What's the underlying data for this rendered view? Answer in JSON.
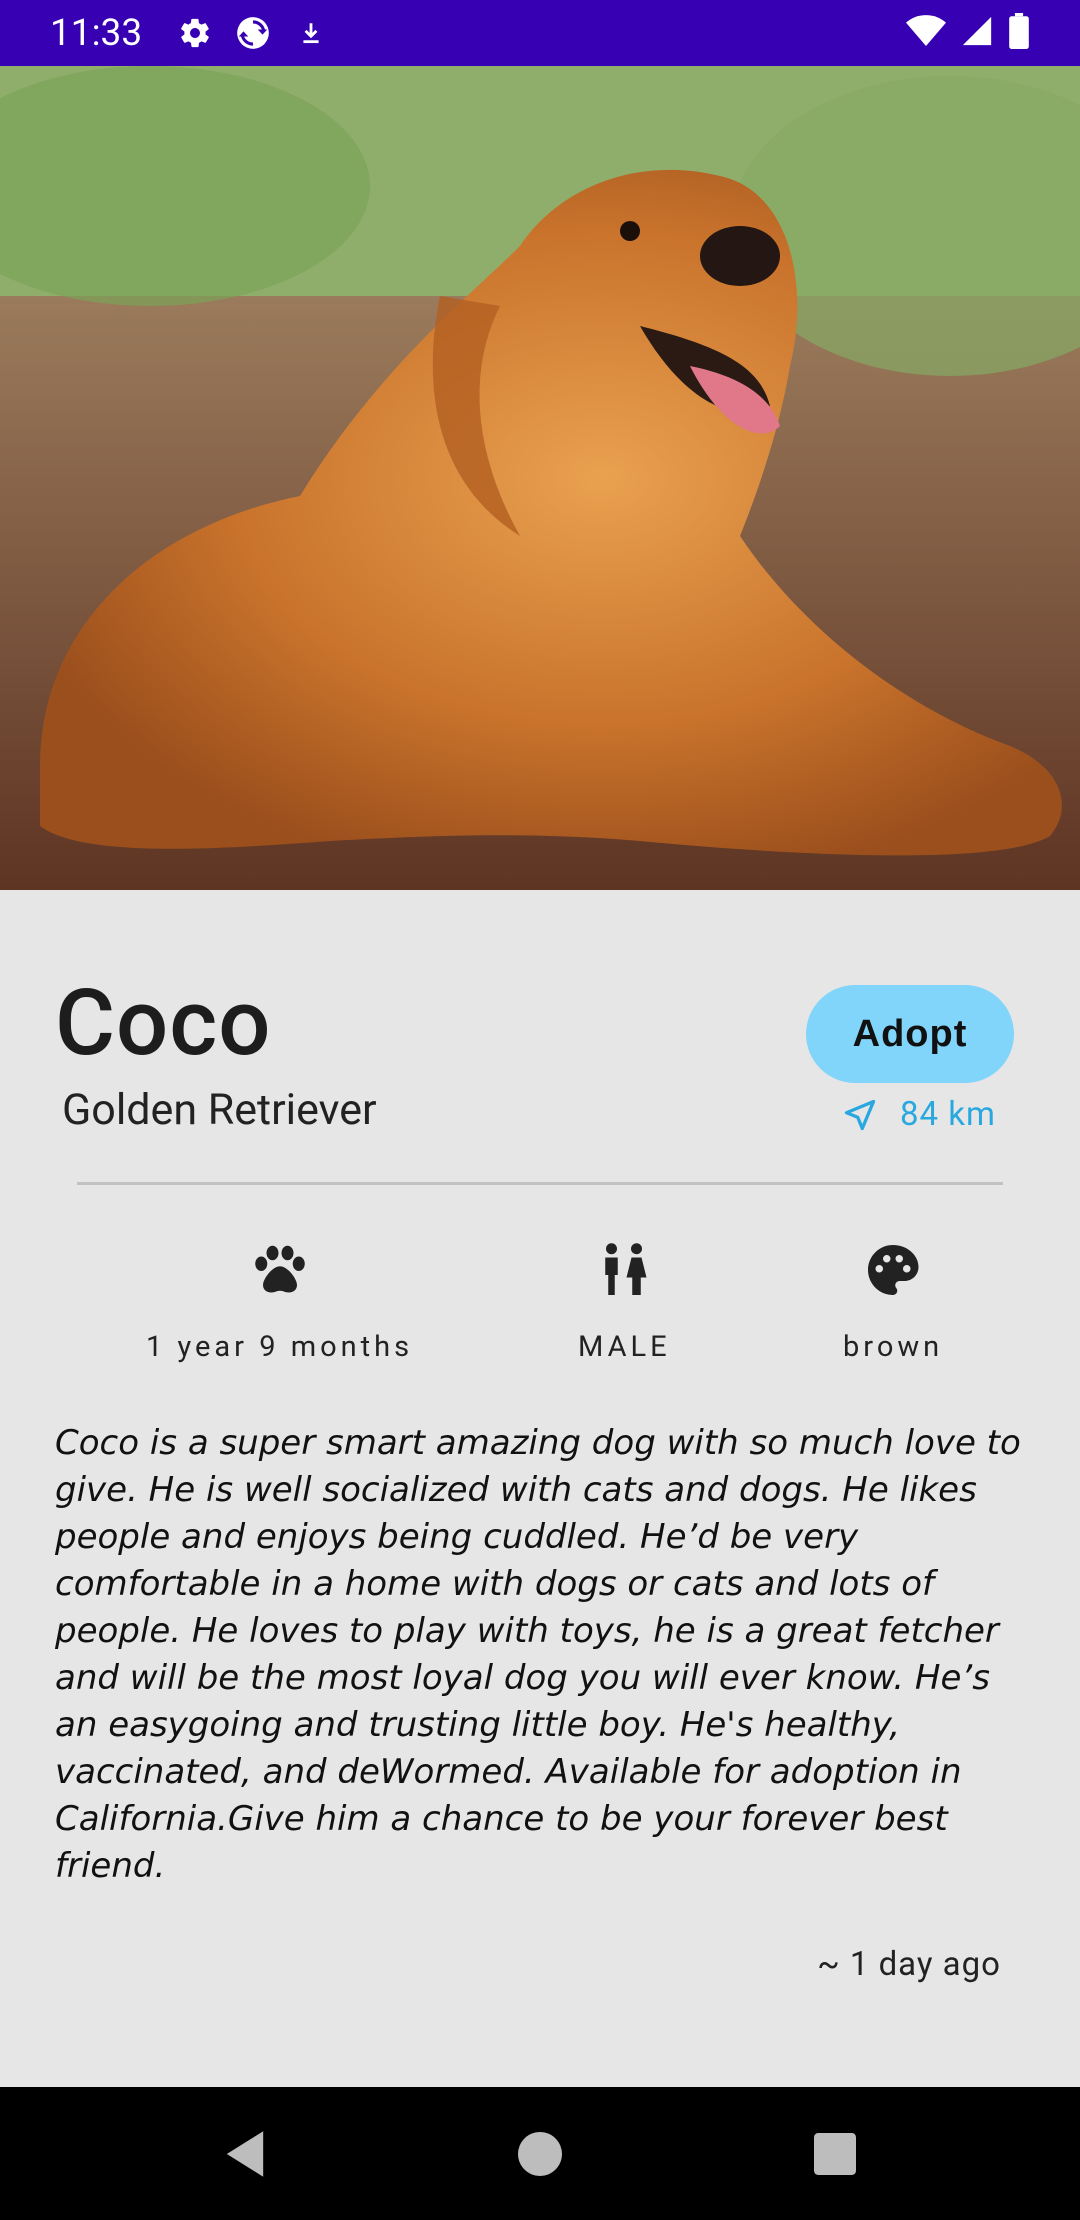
{
  "status_bar": {
    "time": "11:33",
    "icons_left": [
      "settings-icon",
      "sync-icon",
      "download-icon"
    ],
    "icons_right": [
      "wifi-icon",
      "signal-icon",
      "battery-icon"
    ]
  },
  "pet": {
    "name": "Coco",
    "breed": "Golden Retriever",
    "adopt_label": "Adopt",
    "distance": "84 km",
    "attributes": [
      {
        "icon": "paw-icon",
        "label": "1 year 9 months"
      },
      {
        "icon": "gender-icon",
        "label": "MALE"
      },
      {
        "icon": "palette-icon",
        "label": "brown"
      }
    ],
    "description": "Coco is a super smart amazing dog with so much love to give. He is well socialized with cats and dogs. He likes people and enjoys being cuddled. He’d be very comfortable in a home with dogs or cats and lots of people. He loves to play with toys, he is a great fetcher and will be the most loyal dog you will ever know. He’s an easygoing and trusting little boy. He's healthy, vaccinated, and deWormed. Available for adoption in California.Give him a chance to be your forever best friend.",
    "posted_ago": "~ 1 day ago"
  },
  "colors": {
    "status_bar": "#3700b3",
    "adopt_button": "#81d4fa",
    "distance_text": "#29a8e0",
    "background": "#e6e6e6"
  }
}
